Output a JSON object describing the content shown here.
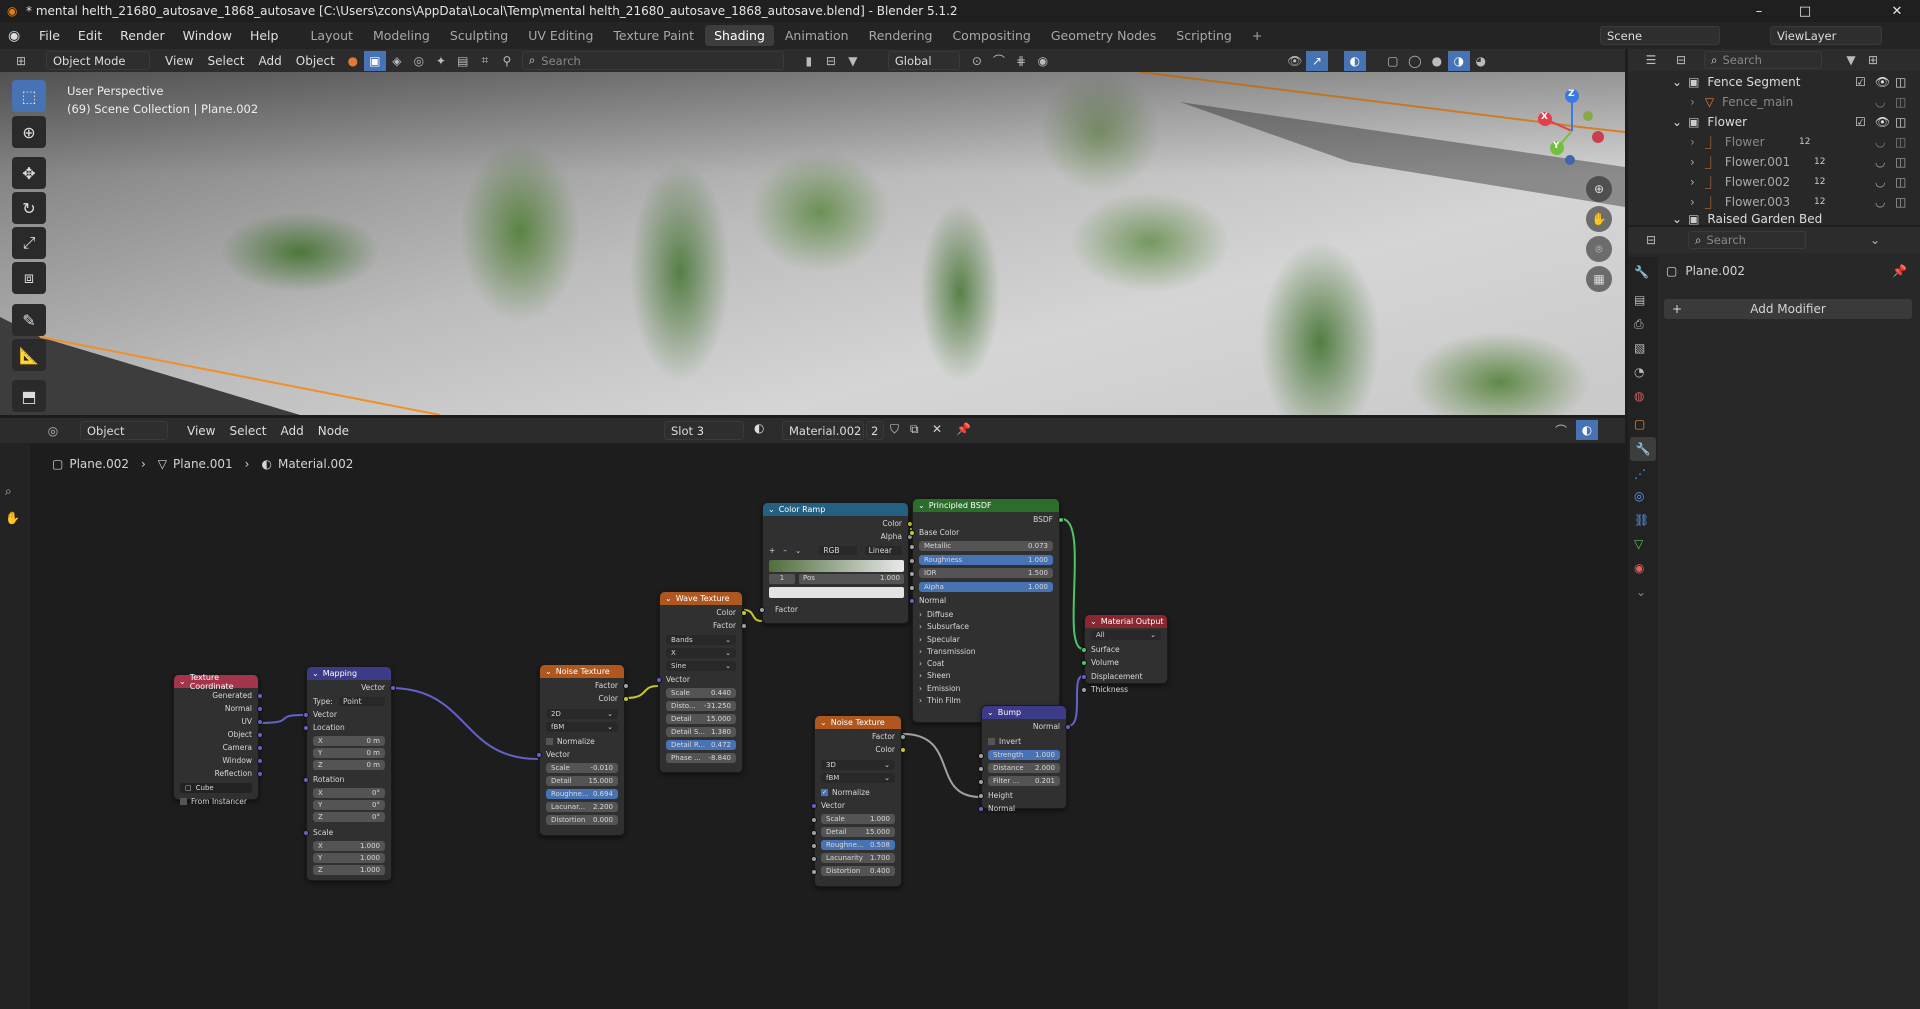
{
  "title_bar": {
    "title": "* mental helth_21680_autosave_1868_autosave [C:\\Users\\zcons\\AppData\\Local\\Temp\\mental helth_21680_autosave_1868_autosave.blend] - Blender 5.1.2",
    "minimize": "–",
    "maximize": "□",
    "close": "✕"
  },
  "menu": [
    "File",
    "Edit",
    "Render",
    "Window",
    "Help"
  ],
  "workspaces": [
    "Layout",
    "Modeling",
    "Sculpting",
    "UV Editing",
    "Texture Paint",
    "Shading",
    "Animation",
    "Rendering",
    "Compositing",
    "Geometry Nodes",
    "Scripting"
  ],
  "workspace_active": "Shading",
  "scene": "Scene",
  "view_layer": "ViewLayer",
  "viewport_header": {
    "mode": "Object Mode",
    "menus": [
      "View",
      "Select",
      "Add",
      "Object"
    ],
    "search_placeholder": "Search",
    "orientation": "Global"
  },
  "viewport": {
    "line1": "User Perspective",
    "line2": "(69) Scene Collection | Plane.002",
    "gizmo": {
      "z": "Z",
      "y": "Y",
      "x": "X"
    }
  },
  "outliner": {
    "search_placeholder": "Search",
    "rows": [
      {
        "label": "Fence Segment"
      },
      {
        "label": "Fence_main"
      },
      {
        "label": "Flower"
      },
      {
        "label": "Flower"
      },
      {
        "label": "Flower.001"
      },
      {
        "label": "Flower.002"
      },
      {
        "label": "Flower.003"
      },
      {
        "label": "Raised Garden Bed"
      }
    ],
    "badge": "12"
  },
  "properties": {
    "search_placeholder": "Search",
    "object": "Plane.002",
    "add_modifier": "Add Modifier"
  },
  "node_header": {
    "type": "Object",
    "menus": [
      "View",
      "Select",
      "Add",
      "Node"
    ],
    "slot": "Slot 3",
    "material": "Material.002",
    "users": "2"
  },
  "breadcrumb": [
    "Plane.002",
    "Plane.001",
    "Material.002"
  ],
  "nodes": {
    "texcoord": {
      "title": "Texture Coordinate",
      "outputs": [
        "Generated",
        "Normal",
        "UV",
        "Object",
        "Camera",
        "Window",
        "Reflection"
      ],
      "object": "Cube",
      "from_instancer": "From Instancer"
    },
    "mapping": {
      "title": "Mapping",
      "out": "Vector",
      "type_label": "Type:",
      "type": "Point",
      "vector": "Vector",
      "location": "Location",
      "loc": [
        "0 m",
        "0 m",
        "0 m"
      ],
      "rotation": "Rotation",
      "rot": [
        "0°",
        "0°",
        "0°"
      ],
      "scale": "Scale",
      "scl": [
        "1.000",
        "1.000",
        "1.000"
      ],
      "axes": [
        "X",
        "Y",
        "Z"
      ]
    },
    "noise1": {
      "title": "Noise Texture",
      "outs": [
        "Factor",
        "Color"
      ],
      "dim": "2D",
      "type": "fBM",
      "normalize": "Normalize",
      "vector": "Vector",
      "fields": [
        [
          "Scale",
          "-0.010"
        ],
        [
          "Detail",
          "15.000"
        ],
        [
          "Roughne...",
          "0.694"
        ],
        [
          "Lacunar...",
          "2.200"
        ],
        [
          "Distortion",
          "0.000"
        ]
      ]
    },
    "wave": {
      "title": "Wave Texture",
      "outs": [
        "Color",
        "Factor"
      ],
      "type": "Bands",
      "dir": "X",
      "profile": "Sine",
      "vector": "Vector",
      "fields": [
        [
          "Scale",
          "0.440"
        ],
        [
          "Disto...",
          "-31.250"
        ],
        [
          "Detail",
          "15.000"
        ],
        [
          "Detail S...",
          "1.380"
        ],
        [
          "Detail R...",
          "0.472"
        ],
        [
          "Phase ...",
          "-8.840"
        ]
      ]
    },
    "ramp": {
      "title": "Color Ramp",
      "outs": [
        "Color",
        "Alpha"
      ],
      "mode": "RGB",
      "interp": "Linear",
      "index": "1",
      "pos_label": "Pos",
      "pos": "1.000",
      "in": "Factor"
    },
    "bsdf": {
      "title": "Principled BSDF",
      "out": "BSDF",
      "base": "Base Color",
      "fields": [
        [
          "Metallic",
          "0.073"
        ],
        [
          "Roughness",
          "1.000"
        ],
        [
          "IOR",
          "1.500"
        ],
        [
          "Alpha",
          "1.000"
        ]
      ],
      "normal": "Normal",
      "panels": [
        "Diffuse",
        "Subsurface",
        "Specular",
        "Transmission",
        "Coat",
        "Sheen",
        "Emission",
        "Thin Film"
      ]
    },
    "output": {
      "title": "Material Output",
      "target": "All",
      "ins": [
        "Surface",
        "Volume",
        "Displacement",
        "Thickness"
      ]
    },
    "noise2": {
      "title": "Noise Texture",
      "outs": [
        "Factor",
        "Color"
      ],
      "dim": "3D",
      "type": "fBM",
      "normalize": "Normalize",
      "vector": "Vector",
      "fields": [
        [
          "Scale",
          "1.000"
        ],
        [
          "Detail",
          "15.000"
        ],
        [
          "Roughne...",
          "0.508"
        ],
        [
          "Lacunarity",
          "1.700"
        ],
        [
          "Distortion",
          "0.400"
        ]
      ]
    },
    "bump": {
      "title": "Bump",
      "out": "Normal",
      "invert": "Invert",
      "fields": [
        [
          "Strength",
          "1.000"
        ],
        [
          "Distance",
          "2.000"
        ],
        [
          "Filter ...",
          "0.201"
        ]
      ],
      "height": "Height",
      "normal": "Normal"
    }
  }
}
